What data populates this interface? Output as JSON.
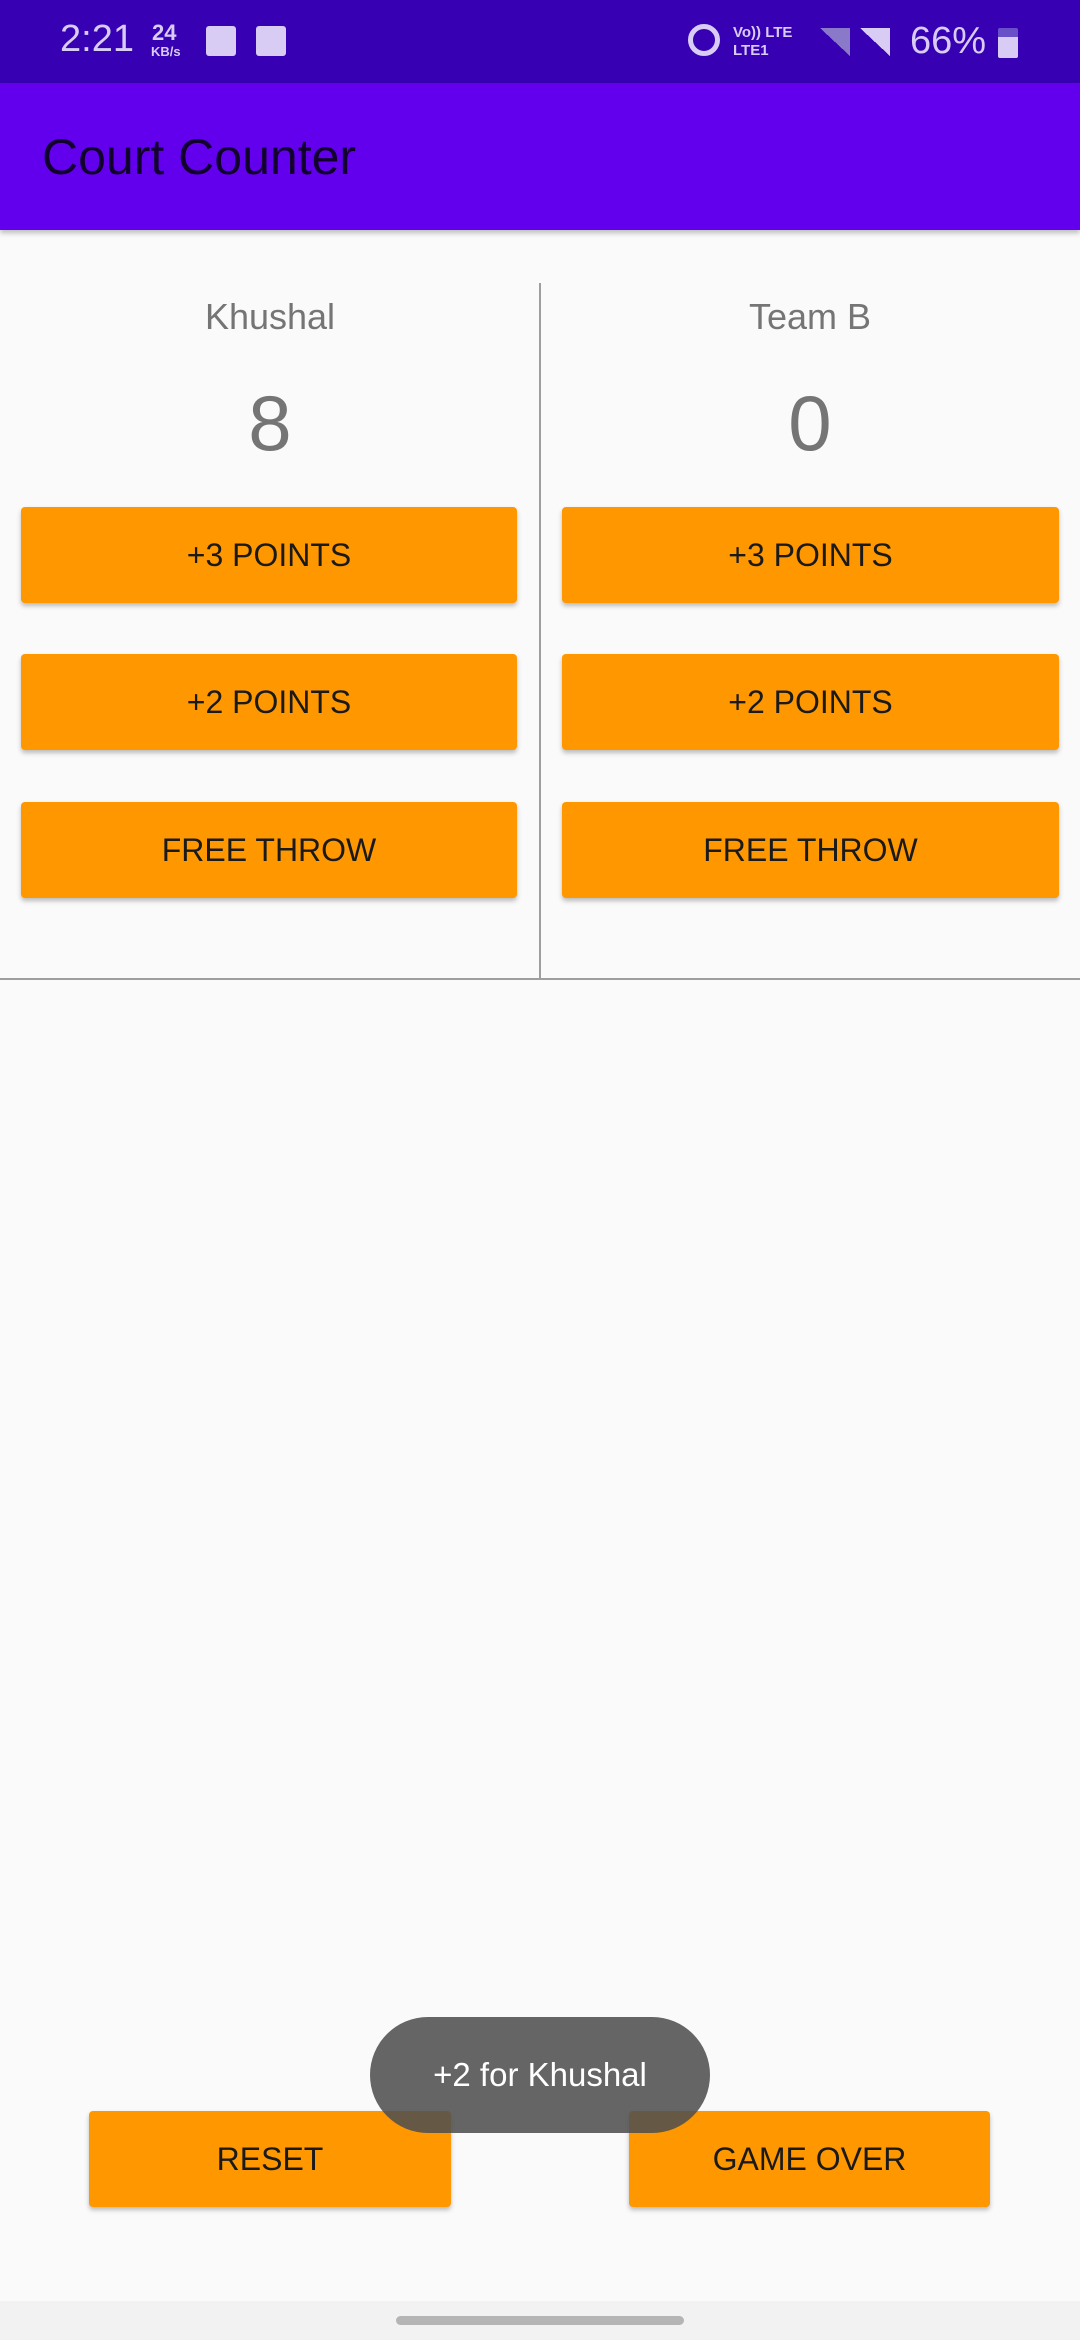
{
  "status_bar": {
    "time": "2:21",
    "speed_value": "24",
    "speed_unit": "KB/s",
    "network_top": "Vo)) LTE",
    "network_bottom": "LTE1",
    "battery": "66%",
    "icons": [
      "image-icon",
      "wifi-hotspot-icon",
      "alarm-icon",
      "signal-icon",
      "signal-icon",
      "battery-icon"
    ]
  },
  "app_bar": {
    "title": "Court Counter"
  },
  "team_a": {
    "name": "Khushal",
    "score": "8",
    "buttons": [
      "+3 POINTS",
      "+2 POINTS",
      "FREE THROW"
    ]
  },
  "team_b": {
    "name": "Team B",
    "score": "0",
    "buttons": [
      "+3 POINTS",
      "+2 POINTS",
      "FREE THROW"
    ]
  },
  "footer": {
    "reset": "RESET",
    "game_over": "GAME OVER"
  },
  "toast": {
    "message": "+2 for Khushal"
  },
  "colors": {
    "status_bar": "#3700b3",
    "app_bar": "#6200ee",
    "button": "#ff9800"
  }
}
